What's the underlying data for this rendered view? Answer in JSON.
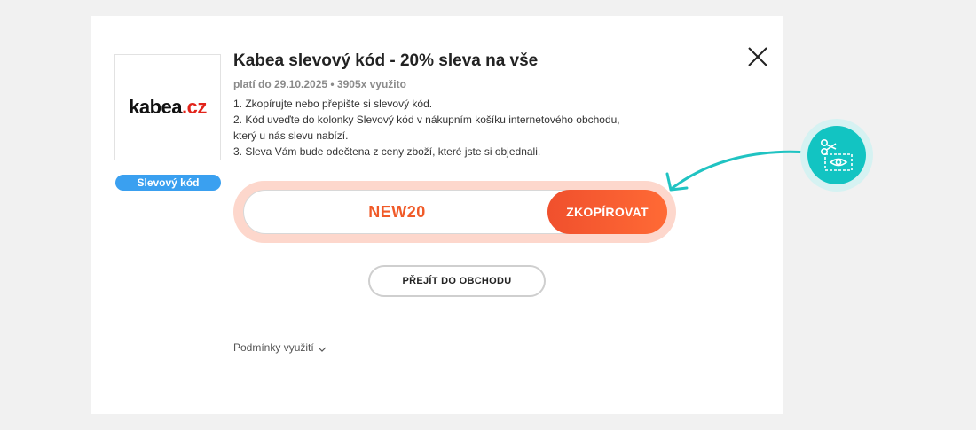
{
  "coupon": {
    "logo": {
      "text_main": "kabea",
      "text_tld": ".cz"
    },
    "badge": "Slevový kód",
    "title": "Kabea slevový kód - 20% sleva na vše",
    "meta": "platí do 29.10.2025 • 3905x využito",
    "instructions": [
      "1. Zkopírujte nebo přepište si slevový kód.",
      "2. Kód uveďte do kolonky Slevový kód v nákupním košíku internetového obchodu, který u nás slevu nabízí.",
      "3. Sleva Vám bude odečtena z ceny zboží, které jste si objednali."
    ],
    "code": "NEW20",
    "copy_label": "ZKOPÍROVAT",
    "shop_label": "PŘEJÍT DO OBCHODU",
    "terms_label": "Podmínky využití"
  },
  "icons": {
    "close": "close-icon",
    "chevron": "chevron-down-icon",
    "fab": "coupon-scissors-eye-icon",
    "arrow": "curved-arrow-icon"
  },
  "colors": {
    "accent": "#f05a28",
    "accent_light": "#fdd7cc",
    "badge": "#3aa0f0",
    "fab": "#12c4c2",
    "fab_halo": "#d6f2f2",
    "logo_tld": "#e2231a"
  }
}
